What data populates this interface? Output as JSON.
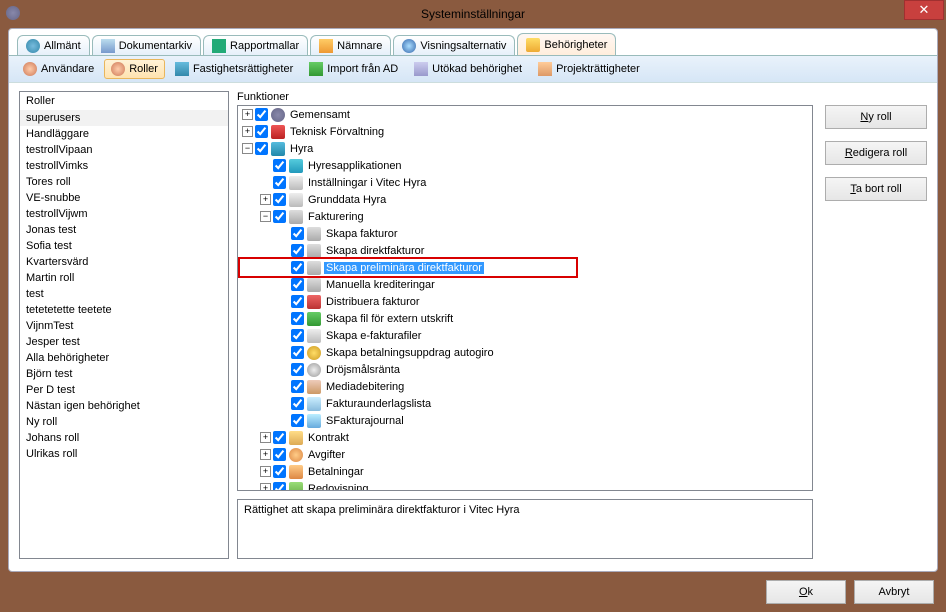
{
  "window": {
    "title": "Systeminställningar"
  },
  "mainTabs": [
    {
      "label": "Allmänt",
      "icon": "ic-globe"
    },
    {
      "label": "Dokumentarkiv",
      "icon": "ic-doc"
    },
    {
      "label": "Rapportmallar",
      "icon": "ic-r"
    },
    {
      "label": "Nämnare",
      "icon": "ic-flag"
    },
    {
      "label": "Visningsalternativ",
      "icon": "ic-eye"
    },
    {
      "label": "Behörigheter",
      "icon": "ic-key",
      "active": true
    }
  ],
  "toolbar": [
    {
      "label": "Användare",
      "icon": "ic-user"
    },
    {
      "label": "Roller",
      "icon": "ic-users",
      "active": true
    },
    {
      "label": "Fastighetsrättigheter",
      "icon": "ic-house"
    },
    {
      "label": "Import från AD",
      "icon": "ic-import"
    },
    {
      "label": "Utökad behörighet",
      "icon": "ic-ext"
    },
    {
      "label": "Projekträttigheter",
      "icon": "ic-proj"
    }
  ],
  "rolesHeader": "Roller",
  "roles": [
    "superusers",
    "Handläggare",
    "testrollVipaan",
    "testrollVimks",
    "Tores roll",
    "VE-snubbe",
    "testrollVijwm",
    "Jonas test",
    "Sofia test",
    "Kvartersvärd",
    "Martin roll",
    "test",
    "tetetetette teetete",
    "VijnmTest",
    "Jesper test",
    "Alla behörigheter",
    "Björn test",
    "Per D test",
    "Nästan igen behörighet",
    "Ny roll",
    "Johans roll",
    "Ulrikas roll"
  ],
  "rolesSelected": 0,
  "funcLabel": "Funktioner",
  "tree": [
    {
      "depth": 0,
      "exp": "+",
      "cb": true,
      "icon": "ic-gear",
      "label": "Gemensamt"
    },
    {
      "depth": 0,
      "exp": "+",
      "cb": true,
      "icon": "ic-red",
      "label": "Teknisk Förvaltning"
    },
    {
      "depth": 0,
      "exp": "-",
      "cb": true,
      "icon": "ic-blue",
      "label": "Hyra"
    },
    {
      "depth": 1,
      "exp": "",
      "cb": true,
      "icon": "ic-bluehome",
      "label": "Hyresapplikationen"
    },
    {
      "depth": 1,
      "exp": "",
      "cb": true,
      "icon": "ic-file",
      "label": "Inställningar i Vitec Hyra"
    },
    {
      "depth": 1,
      "exp": "+",
      "cb": true,
      "icon": "ic-file",
      "label": "Grunddata Hyra"
    },
    {
      "depth": 1,
      "exp": "-",
      "cb": true,
      "icon": "ic-env",
      "label": "Fakturering"
    },
    {
      "depth": 2,
      "exp": "",
      "cb": true,
      "icon": "ic-env",
      "label": "Skapa fakturor"
    },
    {
      "depth": 2,
      "exp": "",
      "cb": true,
      "icon": "ic-env",
      "label": "Skapa direktfakturor"
    },
    {
      "depth": 2,
      "exp": "",
      "cb": true,
      "icon": "ic-env",
      "label": "Skapa preliminära direktfakturor",
      "selected": true,
      "highlighted": true
    },
    {
      "depth": 2,
      "exp": "",
      "cb": true,
      "icon": "ic-env",
      "label": "Manuella krediteringar"
    },
    {
      "depth": 2,
      "exp": "",
      "cb": true,
      "icon": "ic-redarrow",
      "label": "Distribuera fakturor"
    },
    {
      "depth": 2,
      "exp": "",
      "cb": true,
      "icon": "ic-green",
      "label": "Skapa fil för extern utskrift"
    },
    {
      "depth": 2,
      "exp": "",
      "cb": true,
      "icon": "ic-file",
      "label": "Skapa e-fakturafiler"
    },
    {
      "depth": 2,
      "exp": "",
      "cb": true,
      "icon": "ic-coin",
      "label": "Skapa betalningsuppdrag autogiro"
    },
    {
      "depth": 2,
      "exp": "",
      "cb": true,
      "icon": "ic-clock",
      "label": "Dröjsmålsränta"
    },
    {
      "depth": 2,
      "exp": "",
      "cb": true,
      "icon": "ic-media",
      "label": "Mediadebitering"
    },
    {
      "depth": 2,
      "exp": "",
      "cb": true,
      "icon": "ic-list",
      "label": "Fakturaunderlagslista"
    },
    {
      "depth": 2,
      "exp": "",
      "cb": true,
      "icon": "ic-sfile",
      "label": "SFakturajournal"
    },
    {
      "depth": 1,
      "exp": "+",
      "cb": true,
      "icon": "ic-folder",
      "label": "Kontrakt"
    },
    {
      "depth": 1,
      "exp": "+",
      "cb": true,
      "icon": "ic-person",
      "label": "Avgifter"
    },
    {
      "depth": 1,
      "exp": "+",
      "cb": true,
      "icon": "ic-wallet",
      "label": "Betalningar"
    },
    {
      "depth": 1,
      "exp": "+",
      "cb": true,
      "icon": "ic-book",
      "label": "Redovisning"
    }
  ],
  "description": "Rättighet att skapa preliminära direktfakturor i Vitec Hyra",
  "sideButtons": {
    "new": "Ny roll",
    "edit": "Redigera roll",
    "delete": "Ta bort roll"
  },
  "footer": {
    "ok": "Ok",
    "cancel": "Avbryt"
  }
}
